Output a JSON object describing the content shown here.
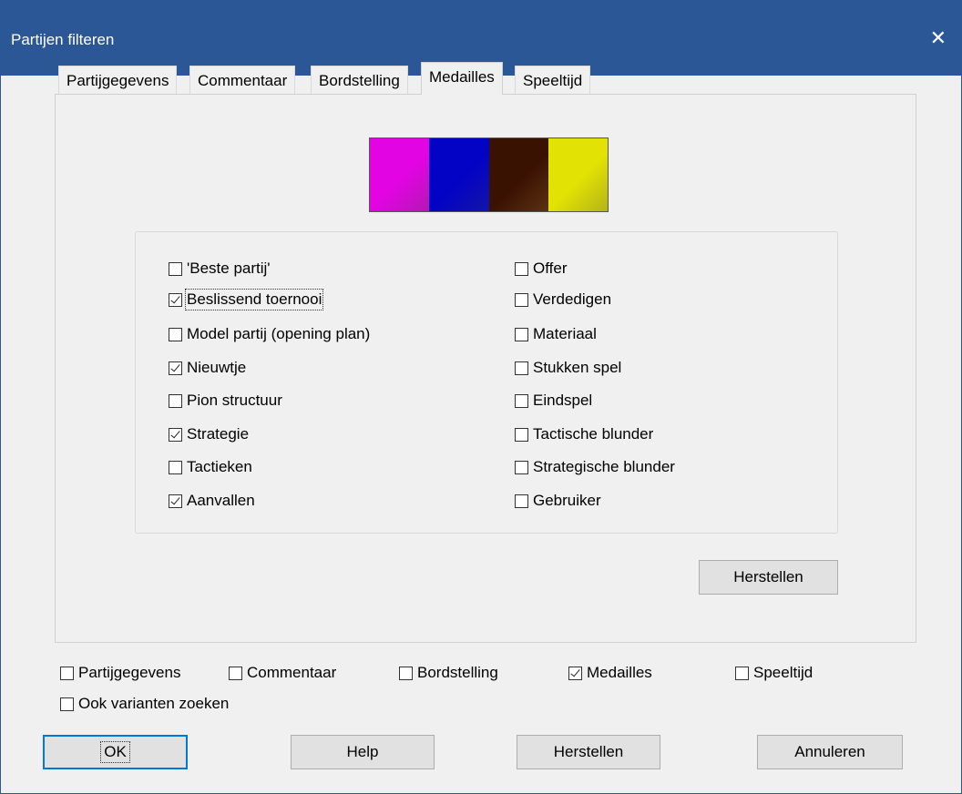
{
  "window": {
    "title": "Partijen filteren"
  },
  "tabs": [
    "Partijgegevens",
    "Commentaar",
    "Bordstelling",
    "Medailles",
    "Speeltijd"
  ],
  "active_tab": "Medailles",
  "medal_colors": [
    "#f020f0",
    "#1c1ce0",
    "#7a4318",
    "#f0f020"
  ],
  "left_options": [
    {
      "label": "'Beste partij'",
      "checked": false
    },
    {
      "label": "Beslissend toernooi",
      "checked": true
    },
    {
      "label": "Model partij (opening plan)",
      "checked": false
    },
    {
      "label": "Nieuwtje",
      "checked": true
    },
    {
      "label": "Pion structuur",
      "checked": false
    },
    {
      "label": "Strategie",
      "checked": true
    },
    {
      "label": "Tactieken",
      "checked": false
    },
    {
      "label": "Aanvallen",
      "checked": true
    }
  ],
  "right_options": [
    {
      "label": "Offer",
      "checked": false
    },
    {
      "label": "Verdedigen",
      "checked": false
    },
    {
      "label": "Materiaal",
      "checked": false
    },
    {
      "label": "Stukken spel",
      "checked": false
    },
    {
      "label": "Eindspel",
      "checked": false
    },
    {
      "label": "Tactische blunder",
      "checked": false
    },
    {
      "label": "Strategische blunder",
      "checked": false
    },
    {
      "label": "Gebruiker",
      "checked": false
    }
  ],
  "panel_reset_label": "Herstellen",
  "bottom_filters": [
    {
      "label": "Partijgegevens",
      "checked": false
    },
    {
      "label": "Commentaar",
      "checked": false
    },
    {
      "label": "Bordstelling",
      "checked": false
    },
    {
      "label": "Medailles",
      "checked": true
    },
    {
      "label": "Speeltijd",
      "checked": false
    }
  ],
  "variants": {
    "label": "Ook varianten zoeken",
    "checked": false
  },
  "buttons": {
    "ok": "OK",
    "help": "Help",
    "reset": "Herstellen",
    "cancel": "Annuleren"
  }
}
